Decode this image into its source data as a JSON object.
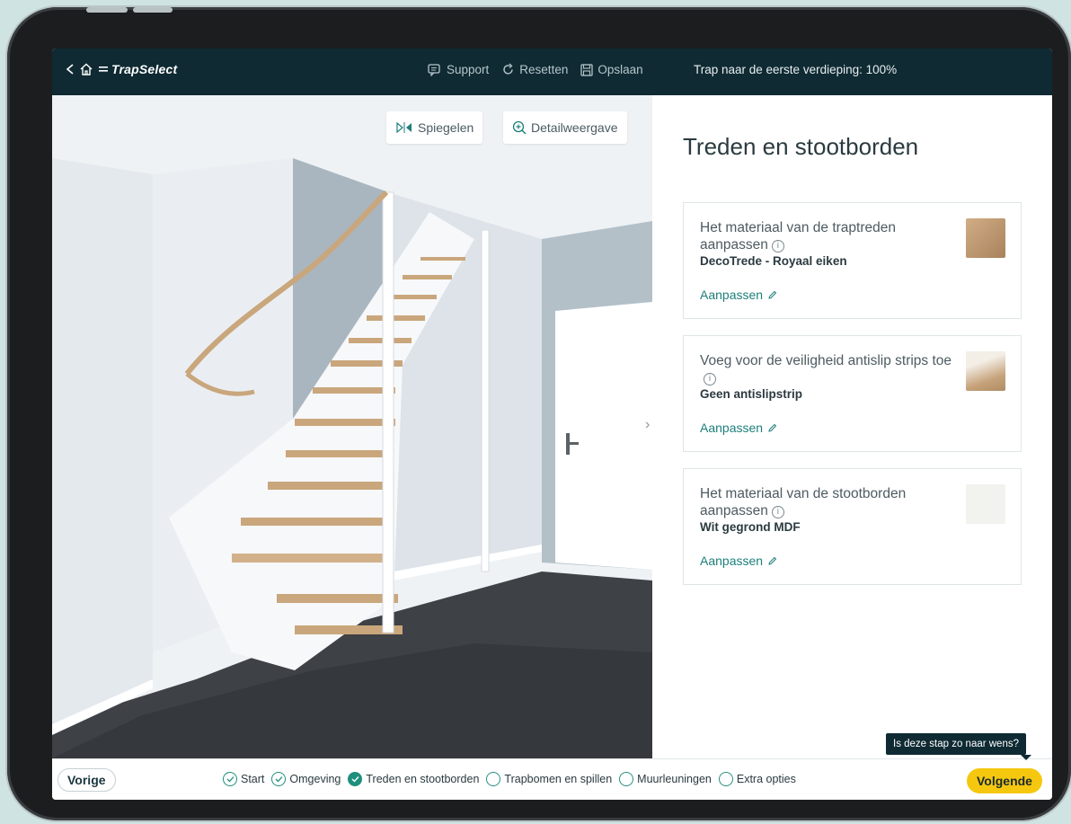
{
  "topbar": {
    "brand": "TrapSelect",
    "actions": [
      {
        "label": "Support",
        "icon": "chat-icon"
      },
      {
        "label": "Resetten",
        "icon": "reset-icon"
      },
      {
        "label": "Opslaan",
        "icon": "save-icon"
      }
    ],
    "status": "Trap naar de eerste verdieping: 100%"
  },
  "viewport": {
    "mirror_label": "Spiegelen",
    "detail_label": "Detailweergave"
  },
  "panel": {
    "title": "Treden en stootborden",
    "cards": [
      {
        "question": "Het materiaal van de traptreden aanpassen",
        "value": "DecoTrede - Royaal eiken",
        "link": "Aanpassen",
        "swatch": "#c19a72"
      },
      {
        "question": "Voeg voor de veiligheid antislip strips toe",
        "value": "Geen antislipstrip",
        "link": "Aanpassen",
        "swatch": "#d8c6b0"
      },
      {
        "question": "Het materiaal van de stootborden aanpassen",
        "value": "Wit gegrond MDF",
        "link": "Aanpassen",
        "swatch": "#f2f2ee"
      }
    ]
  },
  "bottombar": {
    "prev_label": "Vorige",
    "next_label": "Volgende",
    "tooltip": "Is deze stap zo naar wens?",
    "steps": [
      {
        "label": "Start",
        "state": "done"
      },
      {
        "label": "Omgeving",
        "state": "done"
      },
      {
        "label": "Treden en stootborden",
        "state": "active"
      },
      {
        "label": "Trapbomen en spillen",
        "state": "todo"
      },
      {
        "label": "Muurleuningen",
        "state": "todo"
      },
      {
        "label": "Extra opties",
        "state": "todo"
      }
    ]
  },
  "colors": {
    "topbar": "#0f2a33",
    "accent": "#1e8f7d",
    "link": "#1d7f7a",
    "next_button": "#f5c80f"
  }
}
